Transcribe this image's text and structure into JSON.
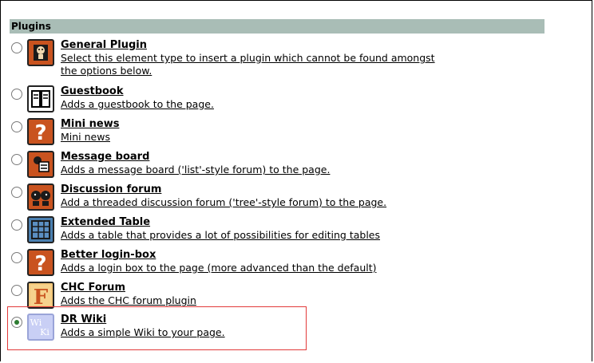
{
  "section_title": "Plugins",
  "items": [
    {
      "title": "General Plugin",
      "desc": "Select this element type to insert a plugin which cannot be found amongst",
      "desc2": "the options below.",
      "icon": "plugin-face-icon",
      "checked": false
    },
    {
      "title": "Guestbook",
      "desc": "Adds a guestbook to the page.",
      "desc2": "",
      "icon": "guestbook-icon",
      "checked": false
    },
    {
      "title": "Mini news",
      "desc": "Mini news",
      "desc2": "",
      "icon": "question-mark-icon",
      "checked": false
    },
    {
      "title": "Message board",
      "desc": "Adds a message board ('list'-style forum) to the page.",
      "desc2": "",
      "icon": "message-board-icon",
      "checked": false
    },
    {
      "title": "Discussion forum",
      "desc": "Add a threaded discussion forum ('tree'-style forum) to the page.",
      "desc2": "",
      "icon": "discussion-forum-icon",
      "checked": false
    },
    {
      "title": "Extended Table",
      "desc": "Adds a table that provides a lot of possibilities for editing tables",
      "desc2": "",
      "icon": "table-icon",
      "checked": false
    },
    {
      "title": "Better login-box",
      "desc": "Adds a login box to the page (more advanced than the default)",
      "desc2": "",
      "icon": "question-mark-icon",
      "checked": false
    },
    {
      "title": "CHC Forum",
      "desc": "Adds the CHC forum plugin",
      "desc2": "",
      "icon": "chc-forum-icon",
      "checked": false
    },
    {
      "title": "DR Wiki",
      "desc": "Adds a simple Wiki to your page.",
      "desc2": "",
      "icon": "wiki-icon",
      "checked": true
    }
  ]
}
